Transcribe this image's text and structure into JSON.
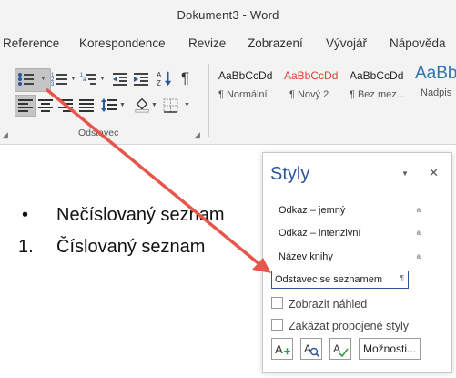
{
  "window": {
    "title": "Dokument3  -  Word"
  },
  "menu": {
    "tabs": [
      "Reference",
      "Korespondence",
      "Revize",
      "Zobrazení",
      "Vývojář",
      "Nápověda"
    ]
  },
  "ribbon": {
    "paragraph_group_label": "Odstavec",
    "styles": [
      {
        "sample": "AaBbCcDd",
        "name": "¶ Normální",
        "color": "#262626"
      },
      {
        "sample": "AaBbCcDd",
        "name": "¶ Nový 2",
        "color": "#e0412f"
      },
      {
        "sample": "AaBbCcDd",
        "name": "¶ Bez mez...",
        "color": "#262626"
      },
      {
        "sample": "AaBb",
        "name": "Nadpis",
        "color": "#2e74b5"
      }
    ],
    "icons": {
      "bullets": "bullet-list-icon",
      "numbering": "numbered-list-icon",
      "multilevel": "multilevel-list-icon",
      "decrease_indent": "decrease-indent-icon",
      "increase_indent": "increase-indent-icon",
      "sort": "sort-icon",
      "show_marks": "pilcrow-icon",
      "align_left": "align-left-icon",
      "align_center": "align-center-icon",
      "align_right": "align-right-icon",
      "justify": "justify-icon",
      "line_spacing": "line-spacing-icon",
      "shading": "shading-icon",
      "borders": "borders-icon"
    }
  },
  "document": {
    "bullet_glyph": "•",
    "bullet_text": "Nečíslovaný seznam",
    "number_glyph": "1.",
    "number_text": "Číslovaný seznam"
  },
  "styles_pane": {
    "title": "Styly",
    "items": [
      {
        "label": "Odkaz – jemný",
        "mark": "a"
      },
      {
        "label": "Odkaz – intenzivní",
        "mark": "a"
      },
      {
        "label": "Název knihy",
        "mark": "a"
      }
    ],
    "selected": {
      "label": "Odstavec se seznamem",
      "mark": "¶"
    },
    "checkbox_preview": "Zobrazit náhled",
    "checkbox_linked": "Zakázat propojené styly",
    "options_button": "Možnosti..."
  },
  "colors": {
    "accent": "#2b579a",
    "annotation_arrow": "#e8554a",
    "ribbon_bg": "#f3f3f3"
  }
}
